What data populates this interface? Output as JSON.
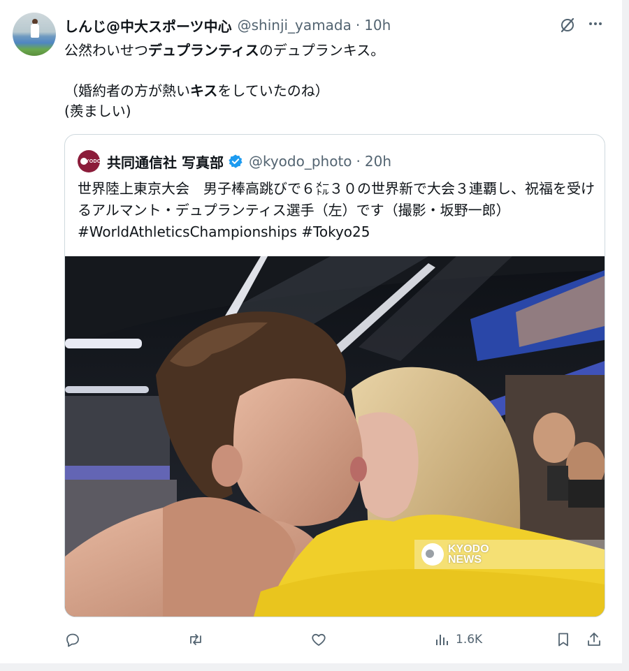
{
  "tweet": {
    "display_name": "しんじ@中大スポーツ中心",
    "handle": "@shinji_yamada",
    "separator": "·",
    "time": "10h",
    "text_line1_a": "公然わいせつ",
    "text_line1_b": "デュプランティス",
    "text_line1_c": "のデュプランキス。",
    "text_line3_a": "（婚約者の方が熱い",
    "text_line3_b": "キス",
    "text_line3_c": "をしていたのね）",
    "text_line4": "(羨ましい)"
  },
  "quote": {
    "avatar_label": "KYODO",
    "display_name": "共同通信社 写真部",
    "handle": "@kyodo_photo",
    "separator": "·",
    "time": "20h",
    "text": "世界陸上東京大会　男子棒高跳びで６㍍３０の世界新で大会３連覇し、祝福を受けるアルマント・デュプランティス選手（左）です（撮影・坂野一郎）#WorldAthleticsChampionships #Tokyo25",
    "watermark_line1": "KYODO",
    "watermark_line2": "NEWS"
  },
  "actions": {
    "views": "1.6K"
  },
  "icons": [
    "grok-icon",
    "more-icon",
    "verified-icon",
    "reply-icon",
    "repost-icon",
    "like-icon",
    "views-icon",
    "bookmark-icon",
    "share-icon"
  ],
  "colors": {
    "text": "#0f1419",
    "secondary": "#536471",
    "border": "#cfd9de",
    "verified": "#1d9bf0",
    "kyodo": "#8b1c3a"
  }
}
